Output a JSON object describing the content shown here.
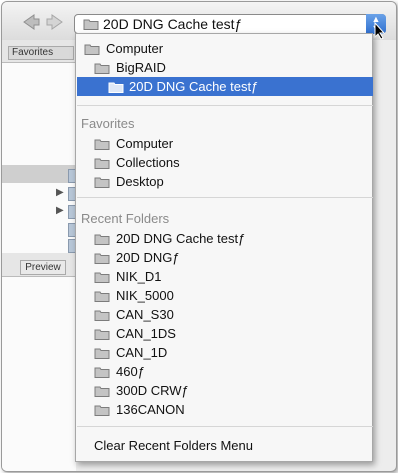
{
  "toolbar": {
    "back_icon": "back-arrow-icon",
    "forward_icon": "forward-arrow-icon",
    "path_popup_label": "20D DNG Cache testƒ"
  },
  "sidebar": {
    "favorites_tab": "Favorites",
    "preview_tab": "Preview"
  },
  "menu": {
    "path_items": [
      {
        "label": "Computer"
      },
      {
        "label": "BigRAID"
      },
      {
        "label": "20D DNG Cache testƒ",
        "selected": true
      }
    ],
    "favorites_heading": "Favorites",
    "favorites": [
      {
        "label": "Computer"
      },
      {
        "label": "Collections"
      },
      {
        "label": "Desktop"
      }
    ],
    "recent_heading": "Recent Folders",
    "recent": [
      {
        "label": "20D DNG Cache testƒ"
      },
      {
        "label": "20D DNGƒ"
      },
      {
        "label": "NIK_D1"
      },
      {
        "label": "NIK_5000"
      },
      {
        "label": "CAN_S30"
      },
      {
        "label": "CAN_1DS"
      },
      {
        "label": "CAN_1D"
      },
      {
        "label": "460ƒ"
      },
      {
        "label": "300D CRWƒ"
      },
      {
        "label": "136CANON"
      }
    ],
    "clear_label": "Clear Recent Folders Menu"
  },
  "colors": {
    "selection": "#3a72d0",
    "heading": "#8a8a8a"
  }
}
